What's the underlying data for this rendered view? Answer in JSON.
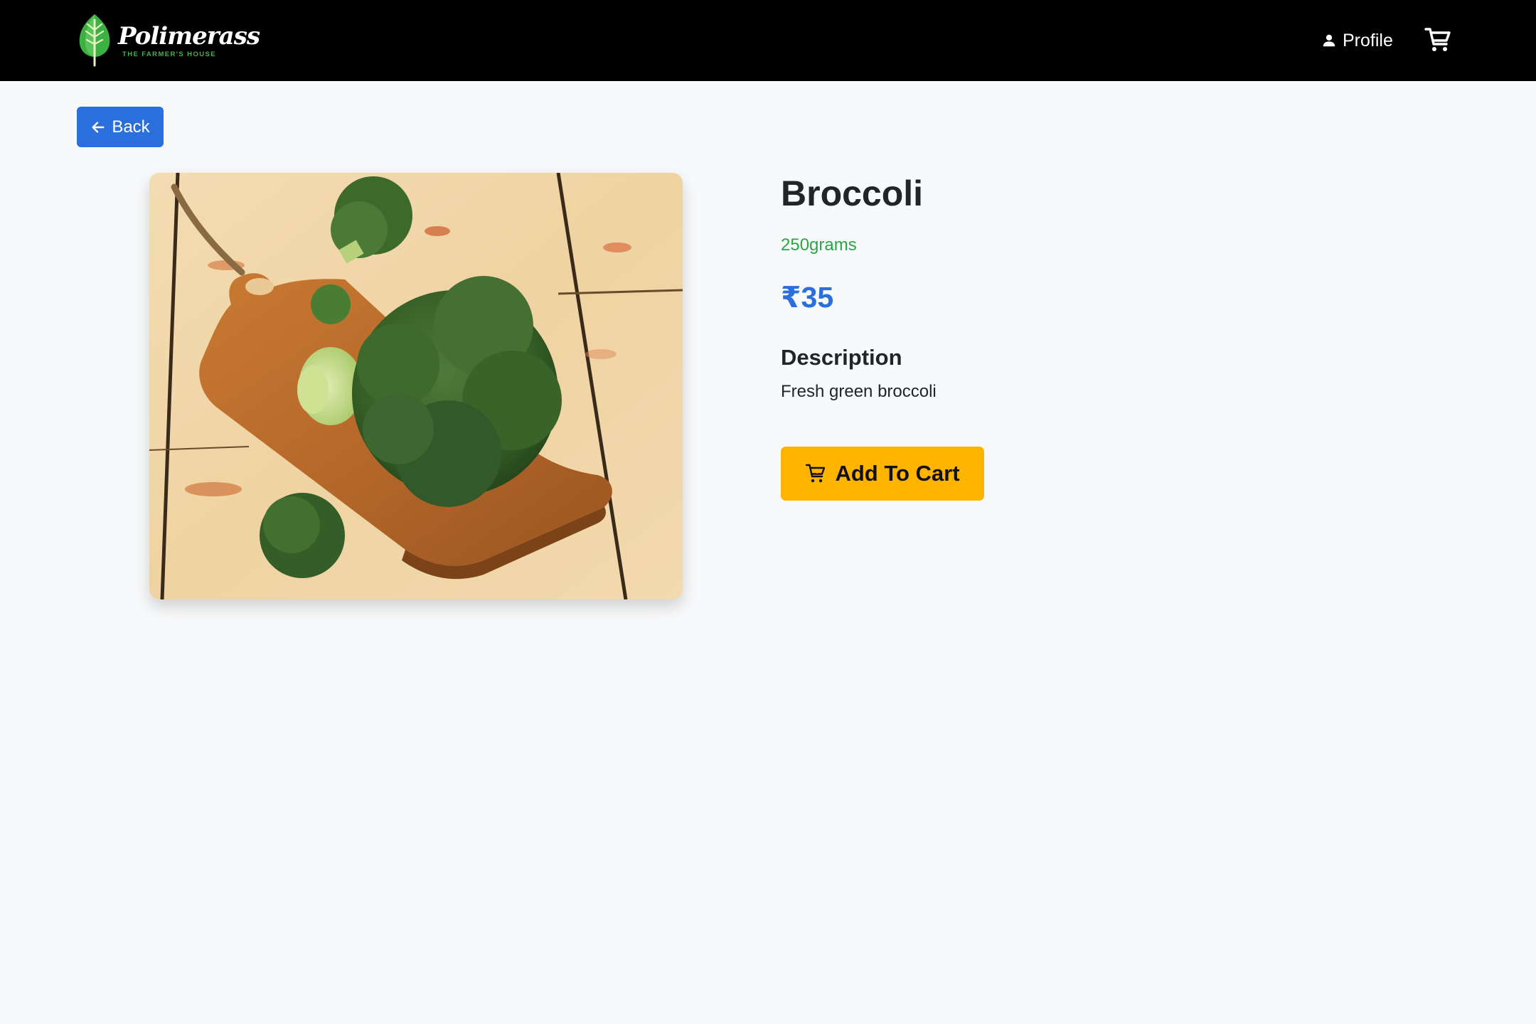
{
  "header": {
    "brand_name": "Polimerass",
    "brand_tagline": "THE FARMER'S HOUSE",
    "profile_label": "Profile",
    "cart_icon": "cart-icon",
    "profile_icon": "person-icon",
    "logo_icon": "leaf-icon"
  },
  "back_button": {
    "label": "Back",
    "icon": "arrow-left-icon"
  },
  "product": {
    "name": "Broccoli",
    "quantity": "250grams",
    "price": "₹35",
    "description_heading": "Description",
    "description": "Fresh green broccoli",
    "add_to_cart_label": "Add To Cart",
    "add_to_cart_icon": "cart-plus-icon",
    "image_subject": "broccoli-photo"
  },
  "colors": {
    "navbar_bg": "#000000",
    "page_bg": "#f8f9fa",
    "primary_blue": "#2a6fdb",
    "quantity_green": "#28a745",
    "cart_button_yellow": "#ffb400"
  }
}
